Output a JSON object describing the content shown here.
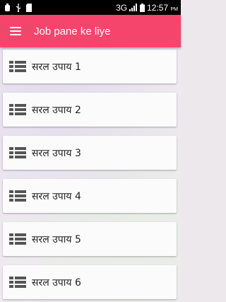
{
  "status_bar": {
    "network": "3G",
    "time": "12:57",
    "ampm": "PM"
  },
  "app_bar": {
    "title": "Job pane ke liye",
    "menu_icon": "hamburger-menu-icon"
  },
  "list": {
    "item_icon": "list-icon",
    "items": [
      {
        "label": "सरल उपाय 1"
      },
      {
        "label": "सरल उपाय 2"
      },
      {
        "label": "सरल उपाय 3"
      },
      {
        "label": "सरल उपाय 4"
      },
      {
        "label": "सरल उपाय 5"
      },
      {
        "label": "सरल उपाय 6"
      }
    ]
  },
  "colors": {
    "accent": "#f6456c",
    "status_bar": "#000000",
    "card": "#fbfbfb"
  }
}
